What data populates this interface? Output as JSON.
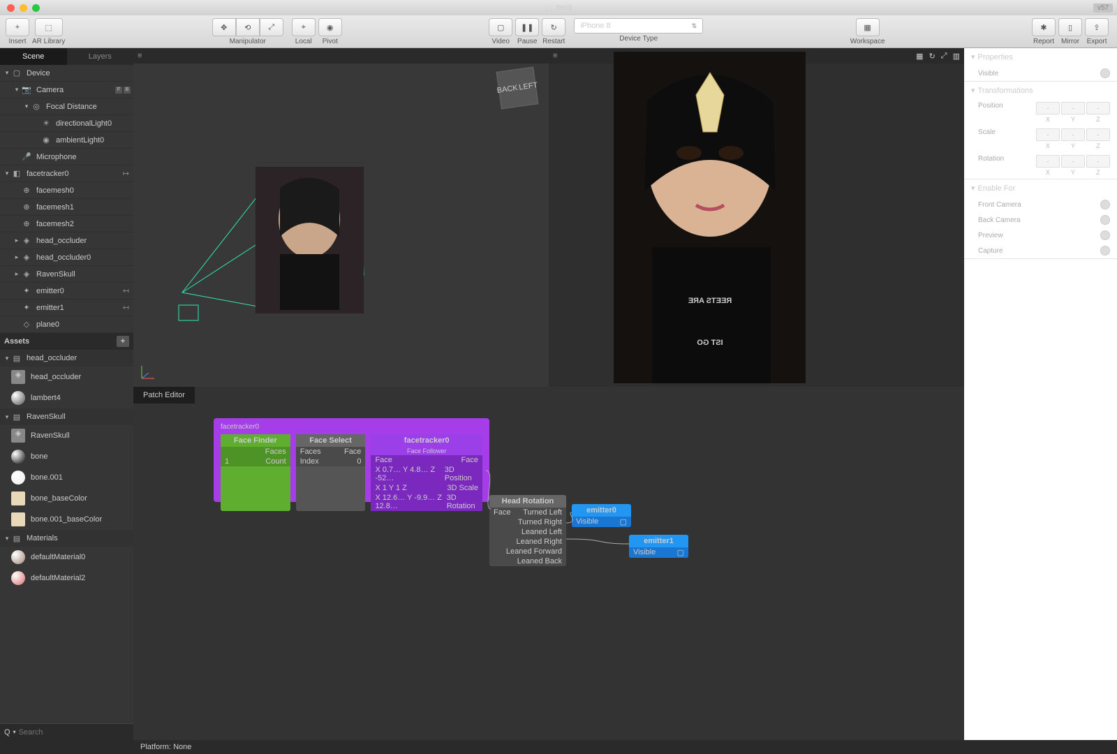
{
  "title": "berd",
  "version_tag": "v57",
  "toolbar": {
    "insert": "Insert",
    "ar_library": "AR Library",
    "manipulator": "Manipulator",
    "local": "Local",
    "pivot": "Pivot",
    "video": "Video",
    "pause": "Pause",
    "restart": "Restart",
    "device_type": "Device Type",
    "device_selected": "iPhone 8",
    "workspace": "Workspace",
    "report": "Report",
    "mirror": "Mirror",
    "export": "Export"
  },
  "left": {
    "tab_scene": "Scene",
    "tab_layers": "Layers",
    "tree": [
      {
        "label": "Device",
        "indent": 0,
        "arrow": "▾",
        "icon": "device"
      },
      {
        "label": "Camera",
        "indent": 1,
        "arrow": "▾",
        "icon": "camera",
        "badges": [
          "F",
          "B"
        ]
      },
      {
        "label": "Focal Distance",
        "indent": 2,
        "arrow": "▾",
        "icon": "focal"
      },
      {
        "label": "directionalLight0",
        "indent": 3,
        "arrow": "",
        "icon": "dlight"
      },
      {
        "label": "ambientLight0",
        "indent": 3,
        "arrow": "",
        "icon": "alight"
      },
      {
        "label": "Microphone",
        "indent": 1,
        "arrow": "",
        "icon": "mic"
      },
      {
        "label": "facetracker0",
        "indent": 0,
        "arrow": "▾",
        "icon": "facetrack",
        "right": "↦"
      },
      {
        "label": "facemesh0",
        "indent": 1,
        "arrow": "",
        "icon": "mesh"
      },
      {
        "label": "facemesh1",
        "indent": 1,
        "arrow": "",
        "icon": "mesh"
      },
      {
        "label": "facemesh2",
        "indent": 1,
        "arrow": "",
        "icon": "mesh"
      },
      {
        "label": "head_occluder",
        "indent": 1,
        "arrow": "▸",
        "icon": "obj"
      },
      {
        "label": "head_occluder0",
        "indent": 1,
        "arrow": "▸",
        "icon": "obj"
      },
      {
        "label": "RavenSkull",
        "indent": 1,
        "arrow": "▸",
        "icon": "obj"
      },
      {
        "label": "emitter0",
        "indent": 1,
        "arrow": "",
        "icon": "emit",
        "right": "↤"
      },
      {
        "label": "emitter1",
        "indent": 1,
        "arrow": "",
        "icon": "emit",
        "right": "↤"
      },
      {
        "label": "plane0",
        "indent": 1,
        "arrow": "",
        "icon": "plane"
      }
    ],
    "assets_header": "Assets",
    "asset_groups": [
      {
        "name": "head_occluder",
        "items": [
          {
            "label": "head_occluder",
            "icon": "cube",
            "color": "#888"
          },
          {
            "label": "lambert4",
            "icon": "sphere",
            "color": "#555"
          }
        ]
      },
      {
        "name": "RavenSkull",
        "items": [
          {
            "label": "RavenSkull",
            "icon": "cube",
            "color": "#888"
          },
          {
            "label": "bone",
            "icon": "sphere",
            "color": "#111"
          },
          {
            "label": "bone.001",
            "icon": "sphere",
            "color": "#eee"
          },
          {
            "label": "bone_baseColor",
            "icon": "swatch",
            "color": "#ead9b8"
          },
          {
            "label": "bone.001_baseColor",
            "icon": "swatch",
            "color": "#ead9b8"
          }
        ]
      },
      {
        "name": "Materials",
        "items": [
          {
            "label": "defaultMaterial0",
            "icon": "sphere",
            "color": "#a08878"
          },
          {
            "label": "defaultMaterial2",
            "icon": "sphere",
            "color": "#d86f6f"
          }
        ]
      }
    ],
    "search_placeholder": "Search"
  },
  "viewcube": {
    "back": "BACK",
    "left": "LEFT"
  },
  "patch": {
    "tab": "Patch Editor",
    "group_title": "facetracker0",
    "face_finder": {
      "title": "Face Finder",
      "out_faces": "Faces",
      "out_count": "Count",
      "count_val": "1"
    },
    "face_select": {
      "title": "Face Select",
      "in_faces": "Faces",
      "in_index": "Index",
      "index_val": "0",
      "out_face": "Face"
    },
    "facetracker": {
      "title": "facetracker0",
      "sub": "Face Follower",
      "in_face": "Face",
      "rows": [
        {
          "l": "Face",
          "r": "Face"
        },
        {
          "l": "X 0.7… Y 4.8… Z -52…",
          "r": "3D Position"
        },
        {
          "l": "X      1 Y      1 Z",
          "r": "3D Scale"
        },
        {
          "l": "X 12.6… Y -9.9… Z 12.8…",
          "r": "3D Rotation"
        }
      ]
    },
    "head_rotation": {
      "title": "Head Rotation",
      "in_face": "Face",
      "outs": [
        "Turned Left",
        "Turned Right",
        "Leaned Left",
        "Leaned Right",
        "Leaned Forward",
        "Leaned Back"
      ]
    },
    "emitter0": {
      "title": "emitter0",
      "in": "Visible"
    },
    "emitter1": {
      "title": "emitter1",
      "in": "Visible"
    }
  },
  "right": {
    "properties": "Properties",
    "visible": "Visible",
    "transformations": "Transformations",
    "position": "Position",
    "scale": "Scale",
    "rotation": "Rotation",
    "enable_for": "Enable For",
    "front_camera": "Front Camera",
    "back_camera": "Back Camera",
    "preview": "Preview",
    "capture": "Capture",
    "placeholder": "-",
    "x": "X",
    "y": "Y",
    "z": "Z"
  },
  "status": {
    "platform": "Platform: None"
  }
}
